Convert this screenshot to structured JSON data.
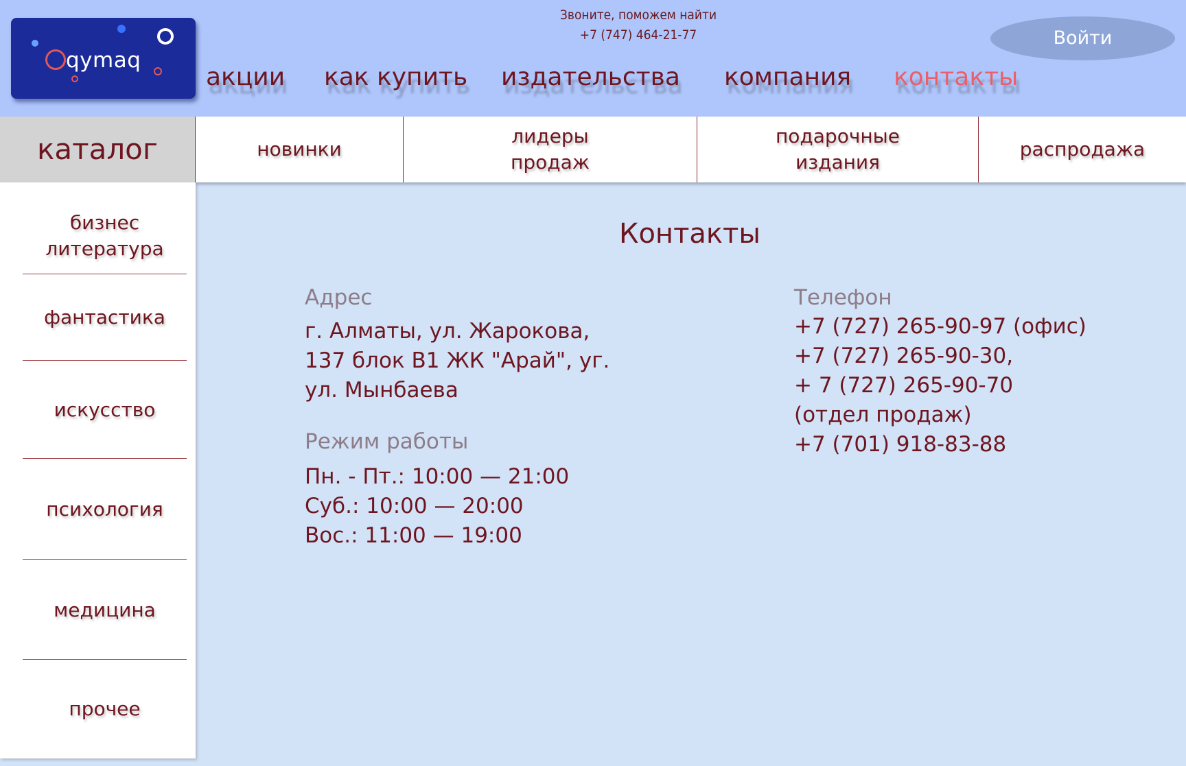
{
  "header": {
    "logo_text": "qymaq",
    "call_line1": "Звоните, поможем найти",
    "call_line2": "+7 (747) 464-21-77",
    "login_label": "Войти",
    "nav": [
      {
        "label": "акции"
      },
      {
        "label": "как купить"
      },
      {
        "label": "издательства"
      },
      {
        "label": "компания"
      },
      {
        "label": "контакты",
        "active": true
      }
    ]
  },
  "catalog_bar": {
    "title": "каталог",
    "tabs": [
      {
        "line1": "новинки",
        "line2": ""
      },
      {
        "line1": "лидеры",
        "line2": "продаж"
      },
      {
        "line1": "подарочные",
        "line2": "издания"
      },
      {
        "line1": "распродажа",
        "line2": ""
      }
    ]
  },
  "sidebar": {
    "items": [
      {
        "line1": "бизнес",
        "line2": "литература"
      },
      {
        "line1": "фантастика",
        "line2": ""
      },
      {
        "line1": "искусство",
        "line2": ""
      },
      {
        "line1": "психология",
        "line2": ""
      },
      {
        "line1": "медицина",
        "line2": ""
      },
      {
        "line1": "прочее",
        "line2": ""
      }
    ]
  },
  "contacts": {
    "title": "Контакты",
    "address_label": "Адрес",
    "address_lines": [
      "г. Алматы, ул. Жарокова,",
      "137 блок В1 ЖК \"Арай\", уг.",
      "ул. Мынбаева"
    ],
    "hours_label": "Режим работы",
    "hours_lines": [
      "Пн. - Пт.: 10:00 — 21:00",
      "Суб.: 10:00 — 20:00",
      "Вос.: 11:00 — 19:00"
    ],
    "phone_label": "Телефон",
    "phone_lines": [
      "+7 (727) 265-90-97 (офис)",
      "+7 (727) 265-90-30,",
      "+ 7 (727) 265-90-70",
      "(отдел продаж)",
      "+7 (701) 918-83-88"
    ]
  },
  "colors": {
    "header_bg": "#aec6fb",
    "content_bg": "#d2e2f7",
    "text_accent": "#6e1620",
    "active_nav": "#ea5f6a",
    "logo_bg": "#1b2b9a"
  }
}
